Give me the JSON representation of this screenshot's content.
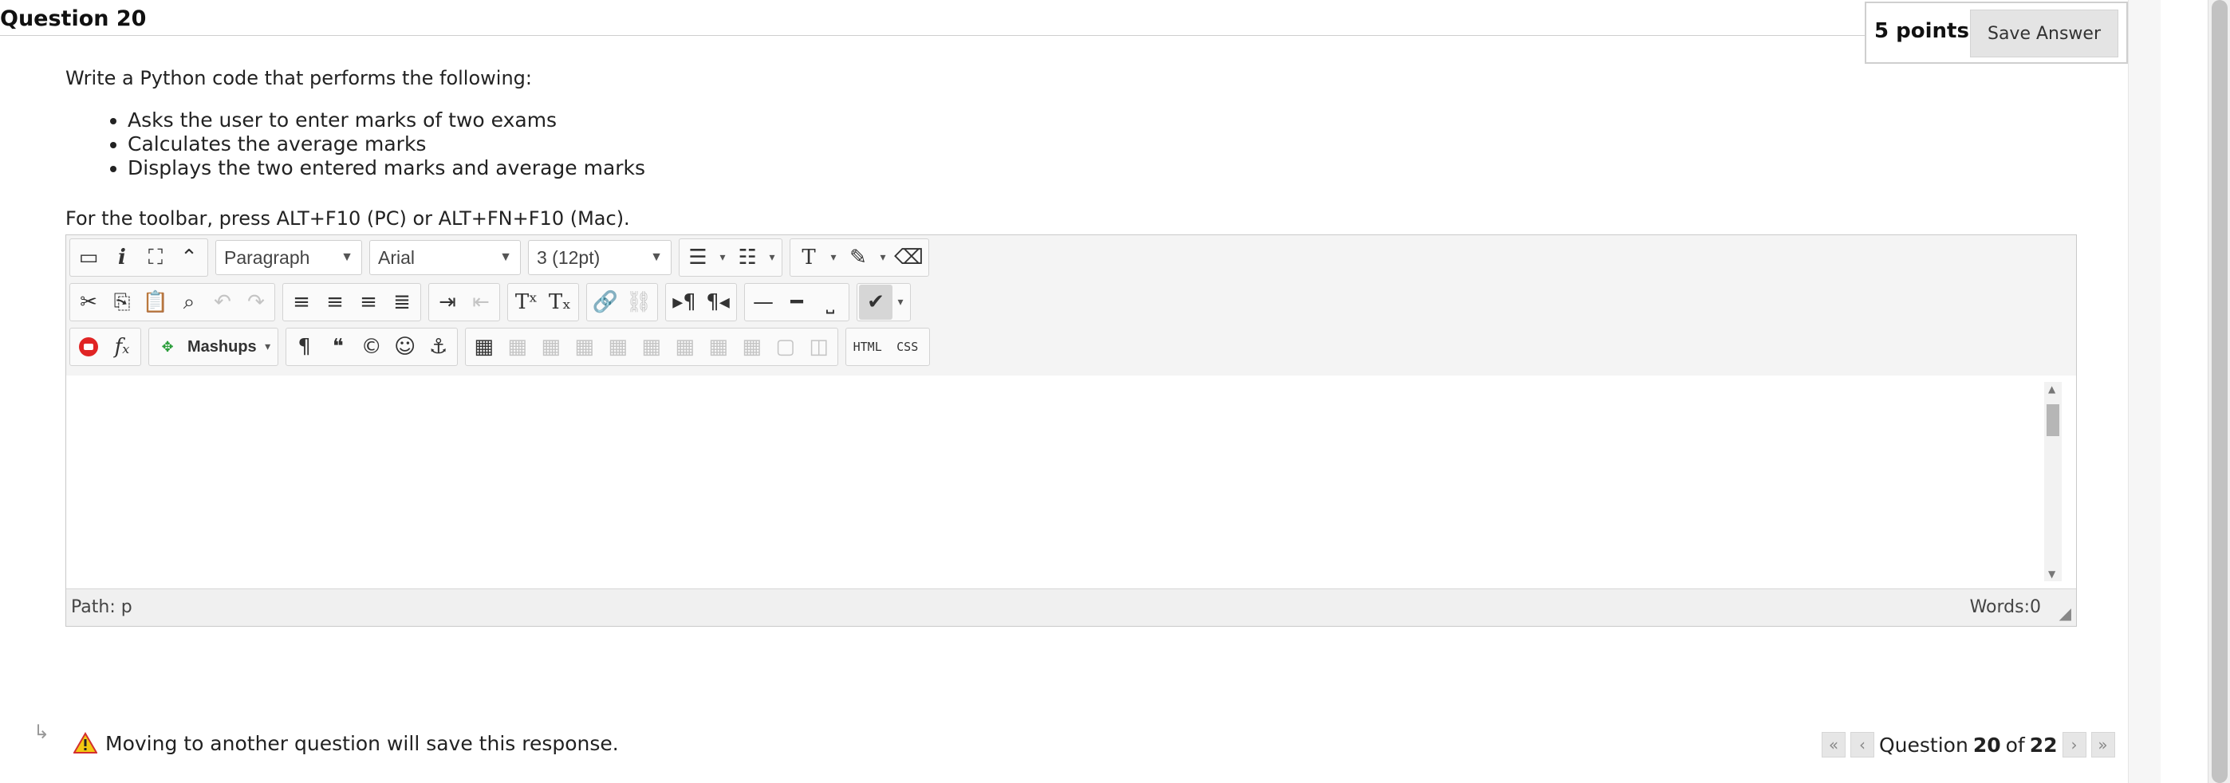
{
  "question": {
    "title": "Question 20",
    "points": "5 points",
    "save_label": "Save Answer",
    "prompt": "Write a Python code that performs the following:",
    "bullets": [
      "Asks the user to enter marks of two exams",
      "Calculates the average marks",
      "Displays the two entered marks and average marks"
    ]
  },
  "editor": {
    "toolbar_hint": "For the toolbar, press ALT+F10 (PC) or ALT+FN+F10 (Mac).",
    "format": "Paragraph",
    "font": "Arial",
    "size": "3 (12pt)",
    "mashups": "Mashups",
    "html_label": "HTML",
    "css_label": "CSS",
    "path": "Path: p",
    "words": "Words:0",
    "icons": {
      "bold": "bold-icon",
      "italic": "italic-icon",
      "underline": "underline-icon",
      "strikethrough": "strikethrough-icon",
      "spellcheck": "spellcheck-icon"
    }
  },
  "footer": {
    "warning": "Moving to another question will save this response.",
    "nav_prefix": "Question",
    "current": "20",
    "of_label": "of",
    "total": "22"
  },
  "colors": {
    "warning_yellow": "#f2c811",
    "warning_red": "#d32f2f",
    "mashup_green": "#2a9d3a",
    "youtube_red": "#e02424"
  }
}
